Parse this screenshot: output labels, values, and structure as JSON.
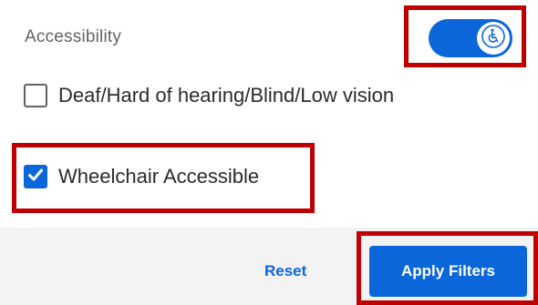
{
  "accessibility": {
    "title": "Accessibility",
    "toggle": {
      "state": "on",
      "icon": "wheelchair-icon",
      "color": "#0a66d9"
    }
  },
  "options": [
    {
      "label": "Deaf/Hard of hearing/Blind/Low vision",
      "checked": false
    },
    {
      "label": "Wheelchair Accessible",
      "checked": true
    }
  ],
  "footer": {
    "reset_label": "Reset",
    "apply_label": "Apply Filters"
  },
  "colors": {
    "accent": "#0a66d9",
    "highlight": "#c00000",
    "footer_bg": "#f3f3f3"
  }
}
